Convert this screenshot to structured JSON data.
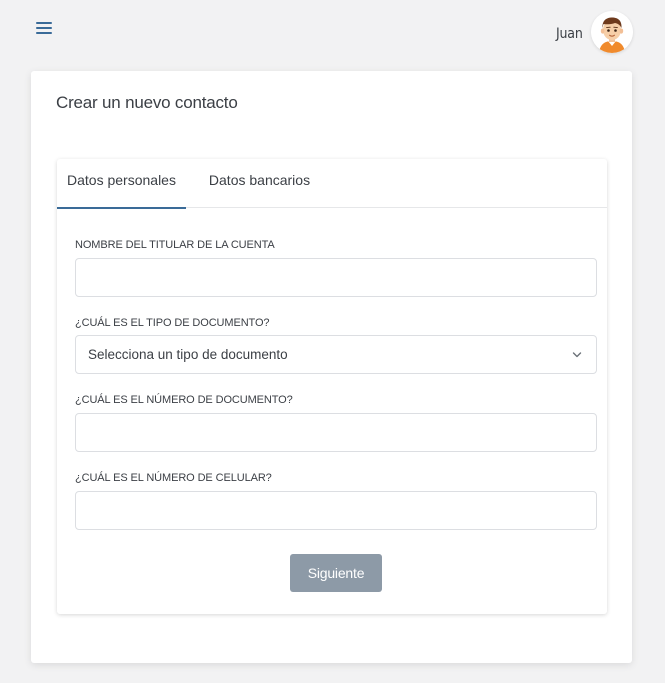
{
  "header": {
    "menu_icon": "hamburger-menu-icon",
    "user_name": "Juan",
    "avatar_icon": "user-avatar"
  },
  "page": {
    "title": "Crear un nuevo contacto"
  },
  "tabs": [
    {
      "label": "Datos personales",
      "active": true
    },
    {
      "label": "Datos bancarios",
      "active": false
    }
  ],
  "form": {
    "holder_name": {
      "label": "NOMBRE DEL TITULAR DE LA CUENTA",
      "value": "",
      "placeholder": ""
    },
    "document_type": {
      "label": "¿CUÁL ES EL TIPO DE DOCUMENTO?",
      "selected": "Selecciona un tipo de documento",
      "icon": "chevron-down-icon"
    },
    "document_number": {
      "label": "¿CUÁL ES EL NÚMERO DE DOCUMENTO?",
      "value": "",
      "placeholder": ""
    },
    "phone_number": {
      "label": "¿CUÁL ES EL NÚMERO DE CELULAR?",
      "value": "",
      "placeholder": ""
    },
    "submit_label": "Siguiente"
  },
  "colors": {
    "accent": "#3a6b98",
    "button_disabled": "#8d9aa7",
    "background": "#f2f2f3"
  }
}
